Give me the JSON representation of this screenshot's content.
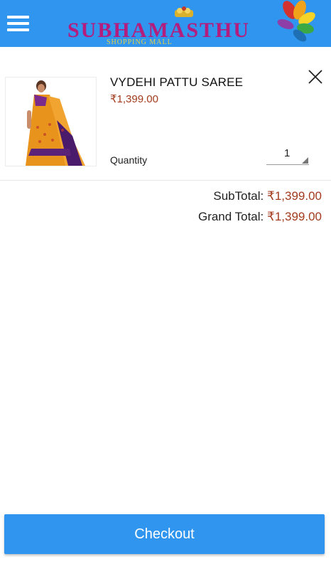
{
  "header": {
    "menu_icon": "hamburger-menu-icon",
    "logo_text": "SUBHAMASTHU",
    "logo_subtitle": "SHOPPING MALL",
    "background_color": "#2f95ef"
  },
  "cart": {
    "item": {
      "name": "VYDEHI PATTU SAREE",
      "price": "₹1,399.00",
      "image_alt": "saree-product-photo",
      "quantity_label": "Quantity",
      "quantity_value": "1",
      "remove_icon": "close-icon"
    },
    "totals": {
      "subtotal_label": "SubTotal:",
      "subtotal_value": "₹1,399.00",
      "grand_total_label": "Grand Total:",
      "grand_total_value": "₹1,399.00"
    }
  },
  "checkout": {
    "label": "Checkout"
  },
  "colors": {
    "accent": "#2f95ef",
    "price": "#a23b1e"
  }
}
